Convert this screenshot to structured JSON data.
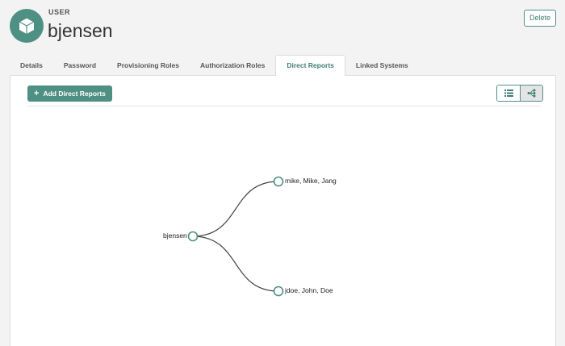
{
  "header": {
    "type_label": "USER",
    "username": "bjensen",
    "delete_label": "Delete"
  },
  "icons": {
    "avatar": "cube-icon",
    "list_view": "list-icon",
    "tree_view": "hierarchy-icon"
  },
  "colors": {
    "accent": "#4f9084",
    "accent_text": "#3e7d72"
  },
  "tabs": [
    {
      "label": "Details",
      "active": false
    },
    {
      "label": "Password",
      "active": false
    },
    {
      "label": "Provisioning Roles",
      "active": false
    },
    {
      "label": "Authorization Roles",
      "active": false
    },
    {
      "label": "Direct Reports",
      "active": true
    },
    {
      "label": "Linked Systems",
      "active": false
    }
  ],
  "toolbar": {
    "add_label": "Add Direct Reports"
  },
  "tree": {
    "root": "bjensen",
    "children": [
      "mike, Mike, Jang",
      "jdoe, John, Doe"
    ]
  }
}
